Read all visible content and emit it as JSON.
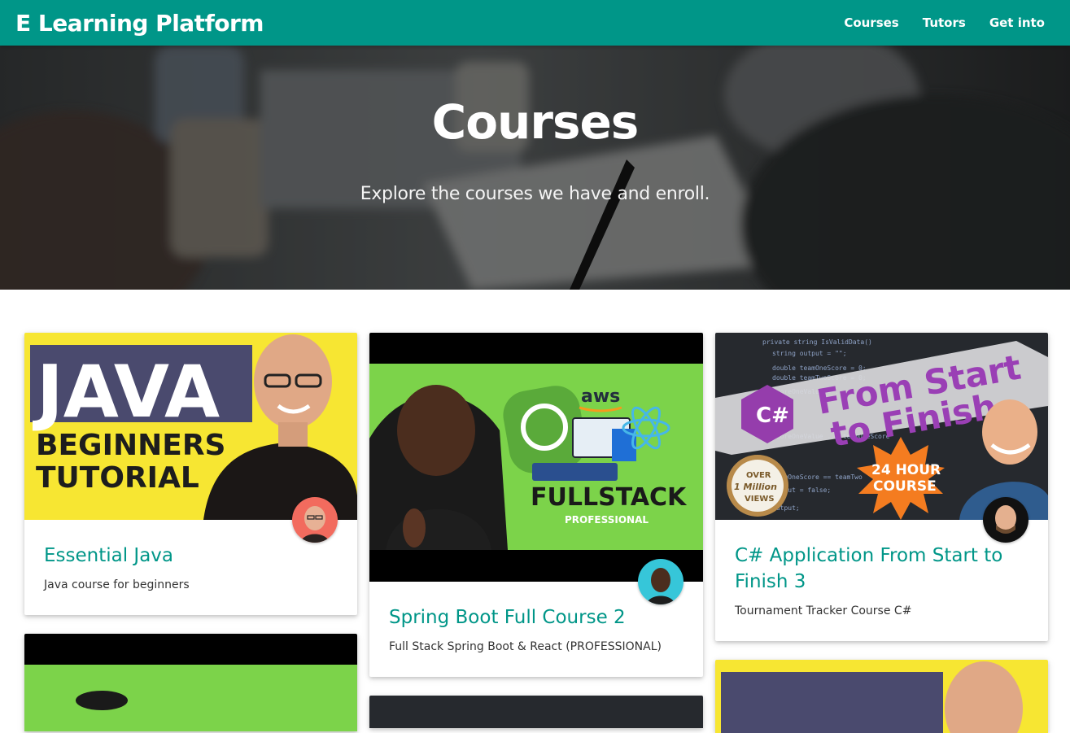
{
  "navbar": {
    "brand": "E Learning Platform",
    "links": [
      "Courses",
      "Tutors",
      "Get into"
    ],
    "color": "#009688"
  },
  "hero": {
    "title": "Courses",
    "subtitle": "Explore the courses we have and enroll."
  },
  "courses": [
    {
      "title": "Essential Java",
      "description": "Java course for beginners",
      "thumb_text": [
        "JAVA",
        "BEGINNERS",
        "TUTORIAL"
      ]
    },
    {
      "title": "Spring Boot Full Course 2",
      "description": "Full Stack Spring Boot & React (PROFESSIONAL)",
      "thumb_text": [
        "aws",
        "FULLSTACK",
        "PROFESSIONAL"
      ]
    },
    {
      "title": "C# Application From Start to Finish 3",
      "description": "Tournament Tracker Course C#",
      "thumb_text": [
        "From Start",
        "to Finish",
        "24 HOUR",
        "COURSE",
        "OVER",
        "1 Million",
        "VIEWS",
        "C#"
      ]
    }
  ],
  "accent": "#009688"
}
